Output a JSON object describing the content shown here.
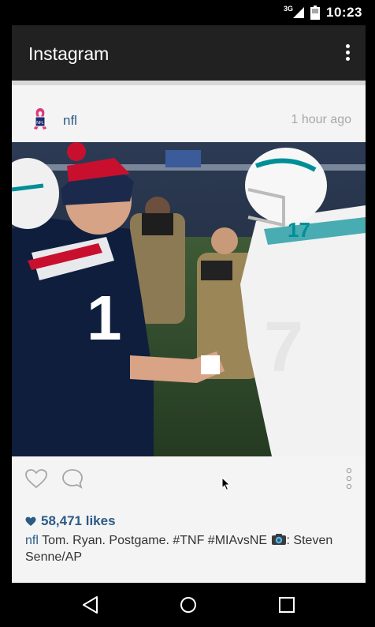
{
  "status_bar": {
    "network": "3G",
    "time": "10:23"
  },
  "toolbar": {
    "title": "Instagram",
    "menu_icon": "overflow-menu-icon"
  },
  "post": {
    "username": "nfl",
    "timestamp": "1 hour ago",
    "likes_count": "58,471 likes",
    "caption_user": "nfl",
    "caption_text": " Tom. Ryan. Postgame. #TNF #MIAvsNE ",
    "caption_credit": ": Steven Senne/AP",
    "photo_icon": "photo-handshake-image"
  },
  "actions": {
    "like_icon": "heart-outline-icon",
    "comment_icon": "comment-bubble-icon",
    "more_icon": "vertical-dots-icon"
  },
  "nav_bar": {
    "back_icon": "back-triangle-icon",
    "home_icon": "home-circle-icon",
    "recents_icon": "recents-square-icon"
  },
  "colors": {
    "toolbar": "#212121",
    "link": "#2b5a86",
    "timestamp": "#a8a8a8",
    "card_bg": "#f4f4f4"
  }
}
